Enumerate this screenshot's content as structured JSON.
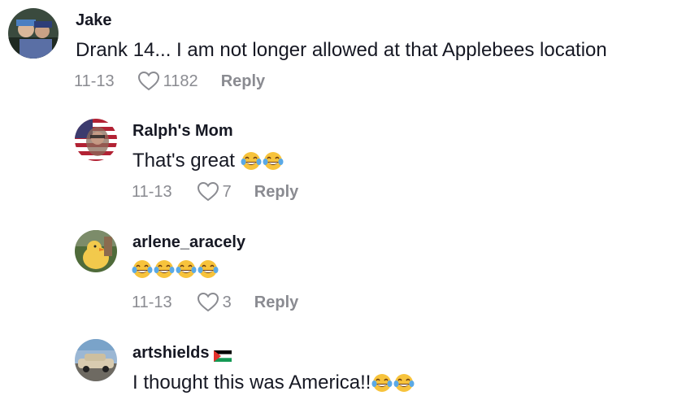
{
  "comments": [
    {
      "username": "Jake",
      "text": "Drank 14... I am not longer allowed at that Applebees location",
      "date": "11-13",
      "likes": "1182",
      "reply_label": "Reply",
      "avatar_icon": "user-avatar",
      "emoji_count": 0
    },
    {
      "username": "Ralph's Mom",
      "text": "That's great",
      "date": "11-13",
      "likes": "7",
      "reply_label": "Reply",
      "avatar_icon": "user-avatar",
      "emoji_count": 2,
      "emoji": "face-with-tears-of-joy"
    },
    {
      "username": "arlene_aracely",
      "text": "",
      "date": "11-13",
      "likes": "3",
      "reply_label": "Reply",
      "avatar_icon": "user-avatar",
      "emoji_count": 4,
      "emoji": "face-with-tears-of-joy"
    },
    {
      "username": "artshields",
      "username_flag": "palestine-flag",
      "text": "I thought this was America!!",
      "avatar_icon": "user-avatar",
      "emoji_count": 2,
      "emoji": "face-with-tears-of-joy"
    }
  ],
  "colors": {
    "text_primary": "#161823",
    "text_secondary": "#8a8b91",
    "emoji_yellow": "#f7c33c",
    "emoji_tear": "#5aa9e6"
  }
}
